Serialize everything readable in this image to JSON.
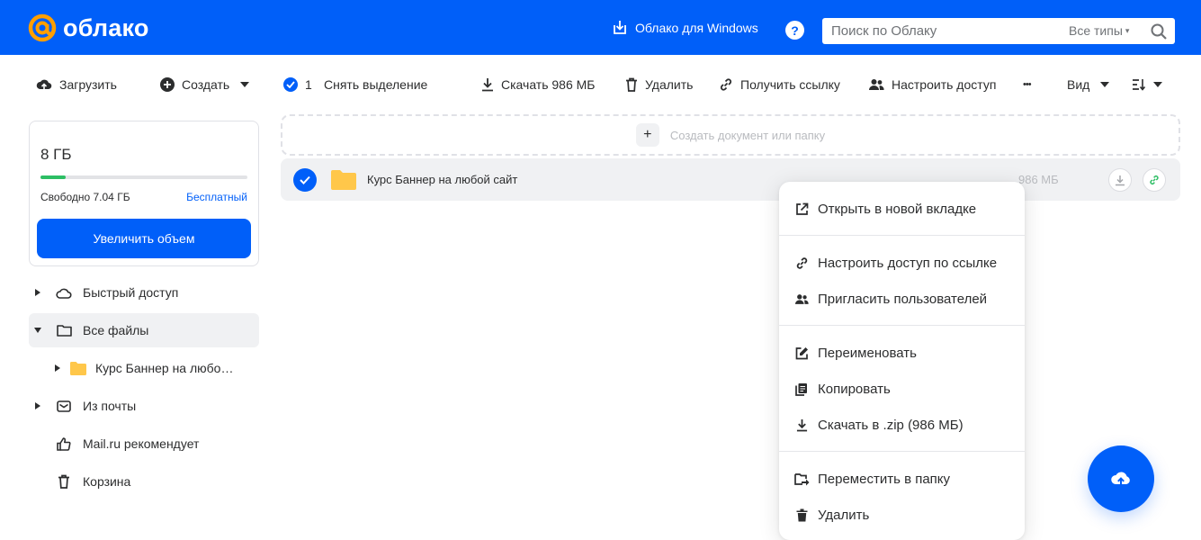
{
  "header": {
    "logo_text": "облако",
    "windows_link": "Облако для Windows",
    "help_label": "?",
    "search_placeholder": "Поиск по Облаку",
    "search_types": "Все типы"
  },
  "toolbar": {
    "upload": "Загрузить",
    "create": "Создать",
    "selected_count": "1",
    "deselect": "Снять выделение",
    "download": "Скачать 986 МБ",
    "delete": "Удалить",
    "get_link": "Получить ссылку",
    "access": "Настроить доступ",
    "more": "•••",
    "view": "Вид"
  },
  "storage": {
    "total": "8 ГБ",
    "free": "Свободно 7.04 ГБ",
    "plan": "Бесплатный",
    "used_fraction": 0.12,
    "upgrade": "Увеличить объем"
  },
  "sidebar": {
    "items": [
      {
        "label": "Быстрый доступ"
      },
      {
        "label": "Все файлы"
      },
      {
        "label": "Курс Баннер на любо…"
      },
      {
        "label": "Из почты"
      },
      {
        "label": "Mail.ru рекомендует"
      },
      {
        "label": "Корзина"
      }
    ]
  },
  "main": {
    "create_placeholder": "Создать документ или папку",
    "plus": "+",
    "file": {
      "name": "Курс Баннер на любой сайт",
      "size": "986 МБ"
    }
  },
  "context_menu": {
    "items": [
      {
        "label": "Открыть в новой вкладке"
      },
      {
        "label": "Настроить доступ по ссылке"
      },
      {
        "label": "Пригласить пользователей"
      },
      {
        "label": "Переименовать"
      },
      {
        "label": "Копировать"
      },
      {
        "label": "Скачать в .zip (986 МБ)"
      },
      {
        "label": "Переместить в папку"
      },
      {
        "label": "Удалить"
      }
    ]
  },
  "colors": {
    "brand": "#005ff9",
    "logo_accent": "#ff9e00",
    "folder": "#ffc74a",
    "progress": "#2dbe64"
  }
}
